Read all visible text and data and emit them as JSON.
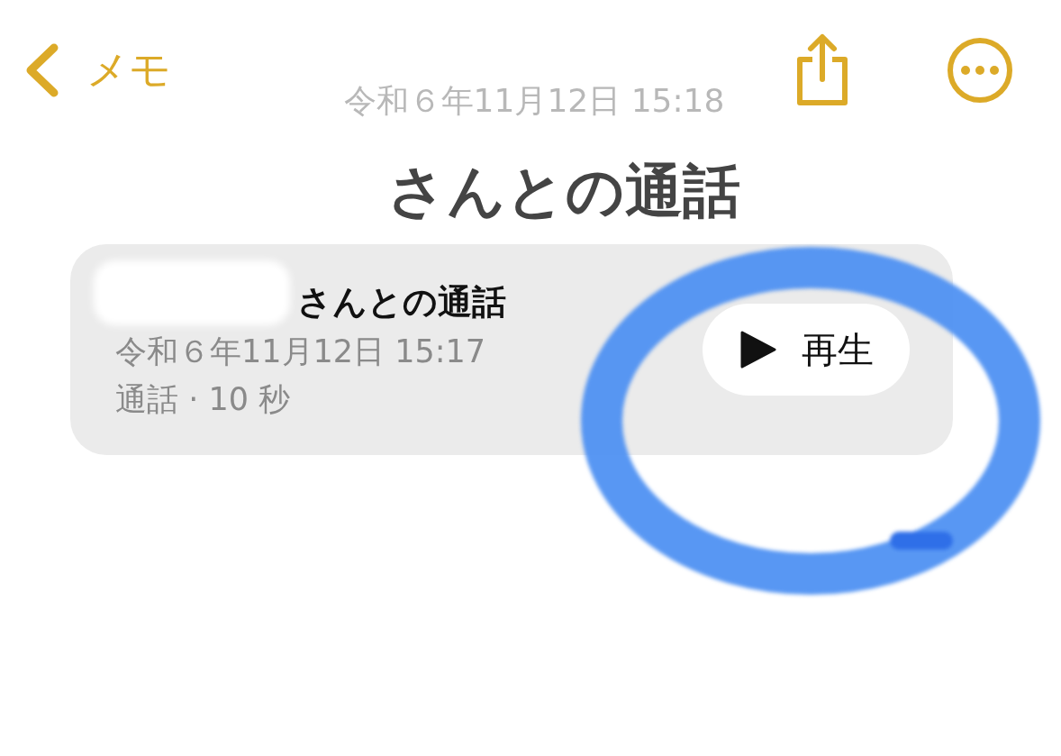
{
  "nav": {
    "back_label": "メモ"
  },
  "note": {
    "date": "令和６年11月12日 15:18",
    "title": "さんとの通話"
  },
  "recording": {
    "title": "さんとの通話",
    "date": "令和６年11月12日 15:17",
    "detail": "通話 · 10 秒",
    "play_label": "再生"
  }
}
